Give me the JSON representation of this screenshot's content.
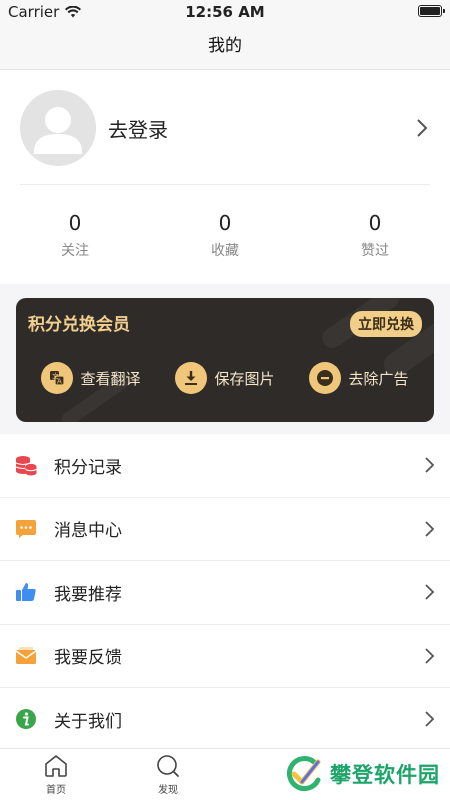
{
  "status_bar": {
    "carrier": "Carrier",
    "time": "12:56 AM"
  },
  "navbar": {
    "title": "我的"
  },
  "profile": {
    "login_label": "去登录",
    "stats": [
      {
        "value": "0",
        "label": "关注"
      },
      {
        "value": "0",
        "label": "收藏"
      },
      {
        "value": "0",
        "label": "赞过"
      }
    ]
  },
  "vip": {
    "title": "积分兑换会员",
    "redeem_button": "立即兑换",
    "features": [
      {
        "icon": "translate-icon",
        "label": "查看翻译"
      },
      {
        "icon": "download-icon",
        "label": "保存图片"
      },
      {
        "icon": "minus-circle-icon",
        "label": "去除广告"
      }
    ],
    "accent": "#f1cf8e"
  },
  "menu": [
    {
      "icon": "coins-icon",
      "label": "积分记录",
      "color": "#e8474d"
    },
    {
      "icon": "message-icon",
      "label": "消息中心",
      "color": "#f5a23a"
    },
    {
      "icon": "thumbs-up-icon",
      "label": "我要推荐",
      "color": "#3d8ef0"
    },
    {
      "icon": "mail-icon",
      "label": "我要反馈",
      "color": "#f5a23a"
    },
    {
      "icon": "info-icon",
      "label": "关于我们",
      "color": "#3aa64a"
    }
  ],
  "tabbar": {
    "tabs": [
      {
        "icon": "home-icon",
        "label": "首页"
      },
      {
        "icon": "discover-icon",
        "label": "发现"
      }
    ],
    "watermark": "攀登软件园"
  }
}
